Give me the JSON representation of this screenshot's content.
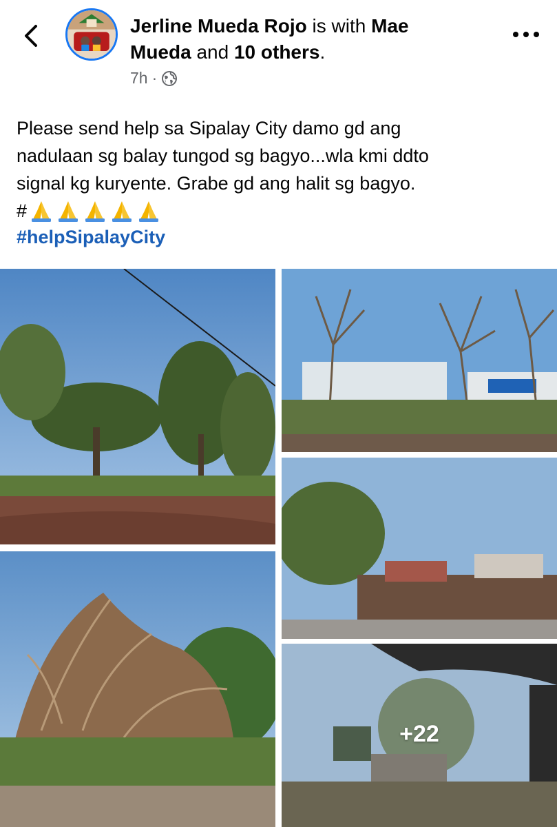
{
  "post": {
    "author": "Jerline Mueda Rojo",
    "with_connector": " is with ",
    "tagged_person_line1": "Mae",
    "tagged_person_line2": "Mueda",
    "and_connector": " and ",
    "others": "10 others",
    "period": ".",
    "time": "7h",
    "separator": "·",
    "privacy_icon": "globe-icon",
    "text_lines": [
      "Please send help sa Sipalay City damo gd ang",
      "nadulaan sg balay tungod sg bagyo...wla kmi ddto",
      "signal kg kuryente. Grabe gd ang halit sg bagyo."
    ],
    "hash_symbol": "#",
    "emoji_name": "folded-hands-emoji",
    "emoji_count": 5,
    "hashtag": "#helpSipalayCity"
  },
  "photos": {
    "more_count": "+22",
    "items": [
      "uprooted trees on road under blue sky",
      "bare trees and debris in front of buildings",
      "fallen tree roots",
      "street with damaged houses",
      "view through vehicle window"
    ]
  },
  "icons": {
    "back": "chevron-left-icon",
    "more": "more-options-icon"
  },
  "colors": {
    "link": "#1b5fb7",
    "meta": "#65676b",
    "avatar_ring": "#1877f2"
  }
}
